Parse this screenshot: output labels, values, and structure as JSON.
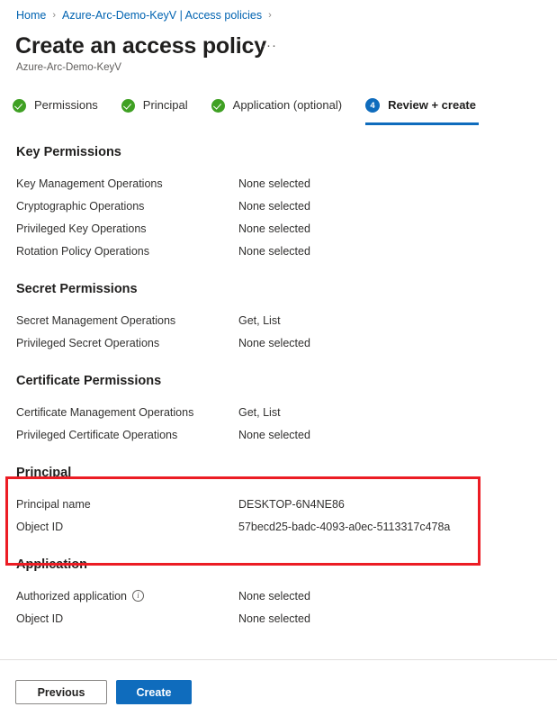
{
  "breadcrumb": {
    "items": [
      {
        "label": "Home"
      },
      {
        "label": "Azure-Arc-Demo-KeyV | Access policies"
      }
    ],
    "separator": "›"
  },
  "header": {
    "title": "Create an access policy",
    "ellipsis": "···",
    "subtitle": "Azure-Arc-Demo-KeyV"
  },
  "tabs": [
    {
      "label": "Permissions",
      "state": "complete",
      "icon": "check-circle-icon",
      "badge": ""
    },
    {
      "label": "Principal",
      "state": "complete",
      "icon": "check-circle-icon",
      "badge": ""
    },
    {
      "label": "Application (optional)",
      "state": "complete",
      "icon": "check-circle-icon",
      "badge": ""
    },
    {
      "label": "Review + create",
      "state": "active",
      "icon": "number-badge-icon",
      "badge": "4"
    }
  ],
  "sections": [
    {
      "title": "Key Permissions",
      "rows": [
        {
          "label": "Key Management Operations",
          "value": "None selected",
          "info": false
        },
        {
          "label": "Cryptographic Operations",
          "value": "None selected",
          "info": false
        },
        {
          "label": "Privileged Key Operations",
          "value": "None selected",
          "info": false
        },
        {
          "label": "Rotation Policy Operations",
          "value": "None selected",
          "info": false
        }
      ]
    },
    {
      "title": "Secret Permissions",
      "rows": [
        {
          "label": "Secret Management Operations",
          "value": "Get, List",
          "info": false
        },
        {
          "label": "Privileged Secret Operations",
          "value": "None selected",
          "info": false
        }
      ]
    },
    {
      "title": "Certificate Permissions",
      "rows": [
        {
          "label": "Certificate Management Operations",
          "value": "Get, List",
          "info": false
        },
        {
          "label": "Privileged Certificate Operations",
          "value": "None selected",
          "info": false
        }
      ]
    },
    {
      "title": "Principal",
      "highlighted": true,
      "rows": [
        {
          "label": "Principal name",
          "value": "DESKTOP-6N4NE86",
          "info": false
        },
        {
          "label": "Object ID",
          "value": "57becd25-badc-4093-a0ec-5113317c478a",
          "info": false
        }
      ]
    },
    {
      "title": "Application",
      "rows": [
        {
          "label": "Authorized application",
          "value": "None selected",
          "info": true,
          "info_glyph": "i"
        },
        {
          "label": "Object ID",
          "value": "None selected",
          "info": false
        }
      ]
    }
  ],
  "footer": {
    "previous_label": "Previous",
    "create_label": "Create"
  },
  "colors": {
    "accent_blue": "#0f6cbd",
    "link_blue": "#0063b1",
    "success_green": "#3fa023",
    "highlight_red": "#ec1c24",
    "text": "#323130"
  }
}
